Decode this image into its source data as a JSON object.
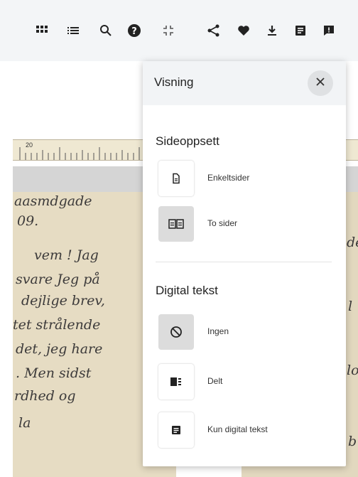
{
  "toolbar": {
    "buttons": [
      {
        "name": "grid-view-icon"
      },
      {
        "name": "list-view-icon"
      },
      {
        "name": "search-icon"
      },
      {
        "name": "help-icon"
      },
      {
        "name": "fullscreen-exit-icon"
      },
      {
        "name": "share-icon"
      },
      {
        "name": "favorite-heart-icon"
      },
      {
        "name": "download-icon"
      },
      {
        "name": "text-document-icon"
      },
      {
        "name": "feedback-icon"
      }
    ]
  },
  "viewer": {
    "ruler_number": "20",
    "left_page_lines": [
      "aasmdgade",
      "09.",
      "vem ! Jag",
      "svare Jeg på",
      "dejlige brev,",
      "tet strålende",
      "det, jeg hare",
      ". Men sidst",
      "rdhed og",
      "la"
    ],
    "right_page_lines": [
      "de",
      "l",
      "lo",
      "b"
    ]
  },
  "panel": {
    "title": "Visning",
    "close_icon": "close-icon",
    "layout_section": {
      "title": "Sideoppsett",
      "options": [
        {
          "label": "Enkeltsider",
          "icon": "single-page-icon",
          "selected": false
        },
        {
          "label": "To sider",
          "icon": "two-pages-icon",
          "selected": true
        }
      ]
    },
    "text_section": {
      "title": "Digital tekst",
      "options": [
        {
          "label": "Ingen",
          "icon": "none-icon",
          "selected": true
        },
        {
          "label": "Delt",
          "icon": "split-view-icon",
          "selected": false
        },
        {
          "label": "Kun digital tekst",
          "icon": "digital-text-only-icon",
          "selected": false
        }
      ]
    }
  }
}
